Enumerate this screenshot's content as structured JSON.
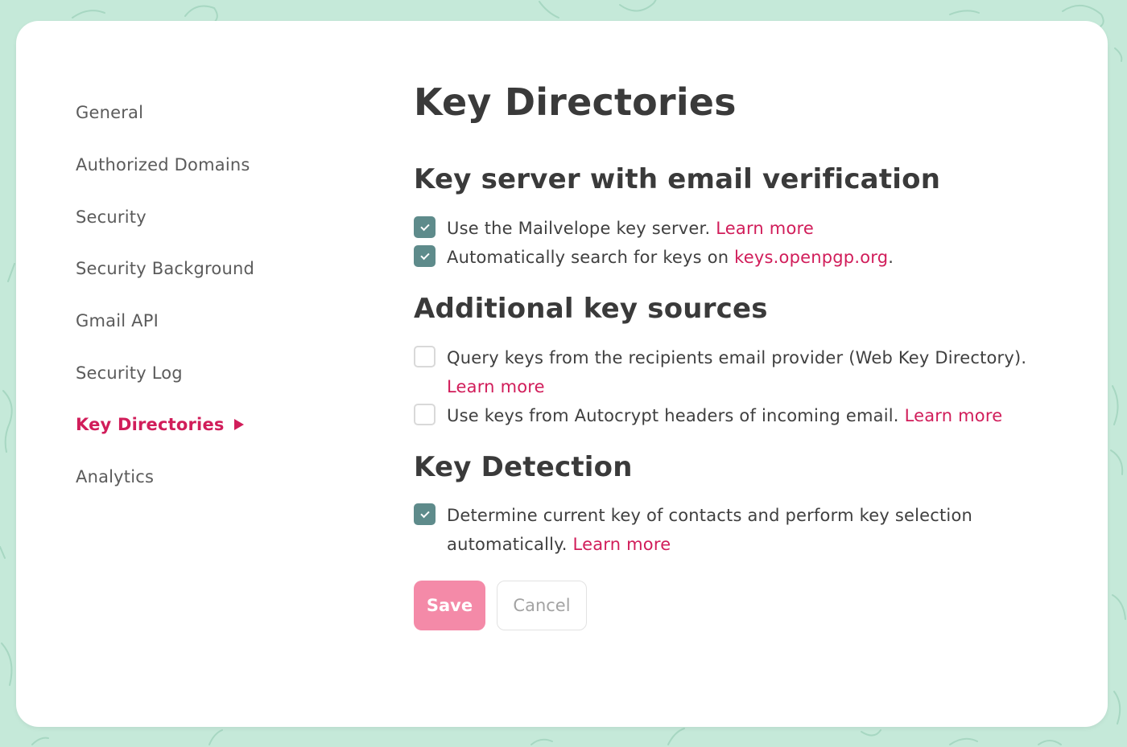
{
  "sidebar": {
    "items": [
      {
        "label": "General"
      },
      {
        "label": "Authorized Domains"
      },
      {
        "label": "Security"
      },
      {
        "label": "Security Background"
      },
      {
        "label": "Gmail API"
      },
      {
        "label": "Security Log"
      },
      {
        "label": "Key Directories",
        "active": true
      },
      {
        "label": "Analytics"
      }
    ]
  },
  "main": {
    "title": "Key Directories",
    "sections": [
      {
        "title": "Key server with email verification",
        "options": [
          {
            "checked": true,
            "text": "Use the Mailvelope key server.",
            "link": "Learn more",
            "suffix": ""
          },
          {
            "checked": true,
            "text": "Automatically search for keys on",
            "link": "keys.openpgp.org",
            "suffix": "."
          }
        ]
      },
      {
        "title": "Additional key sources",
        "options": [
          {
            "checked": false,
            "text": "Query keys from the recipients email provider (Web Key Directory).",
            "link": "Learn more",
            "suffix": ""
          },
          {
            "checked": false,
            "text": "Use keys from Autocrypt headers of incoming email.",
            "link": "Learn more",
            "suffix": ""
          }
        ]
      },
      {
        "title": "Key Detection",
        "options": [
          {
            "checked": true,
            "text": "Determine current key of contacts and perform key selection automatically.",
            "link": "Learn more",
            "suffix": ""
          }
        ]
      }
    ],
    "buttons": {
      "save": "Save",
      "cancel": "Cancel"
    }
  },
  "colors": {
    "accent": "#d11d5a",
    "checkbox_checked": "#5e8b8b",
    "save_button": "#f48aa8",
    "background": "#c5e9d9"
  }
}
